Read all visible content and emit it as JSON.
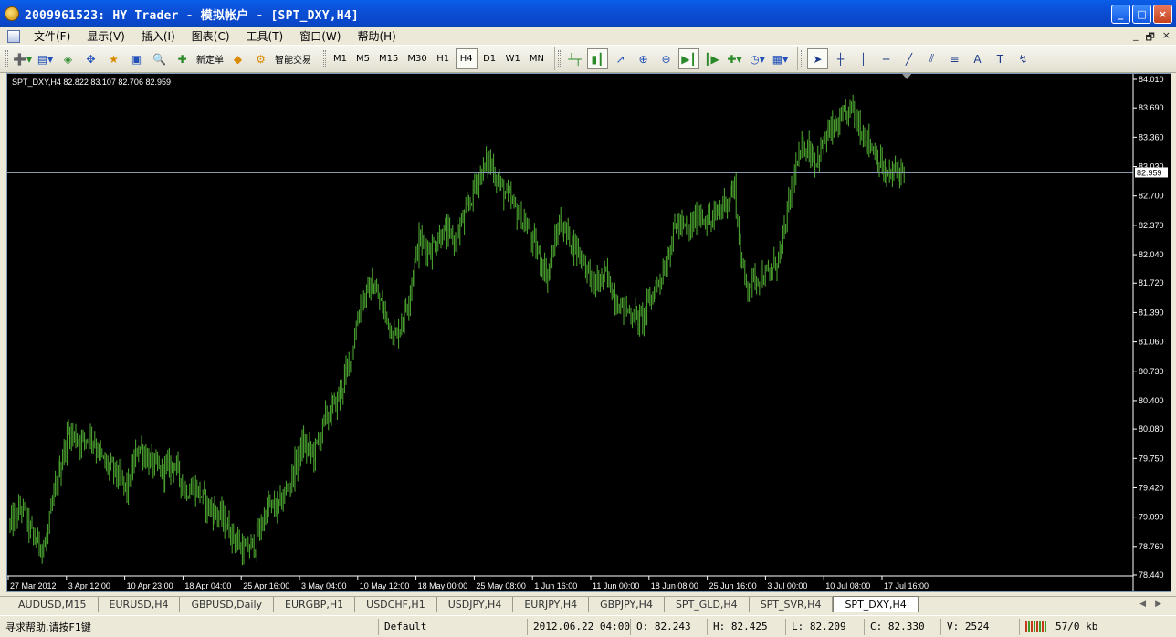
{
  "window": {
    "title": "2009961523: HY Trader - 模拟帐户 - [SPT_DXY,H4]",
    "controls": [
      "_",
      "□",
      "×"
    ]
  },
  "menu": {
    "items": [
      "文件(F)",
      "显示(V)",
      "插入(I)",
      "图表(C)",
      "工具(T)",
      "窗口(W)",
      "帮助(H)"
    ],
    "mdi_controls": [
      "_",
      "🗗",
      "×"
    ]
  },
  "toolbar": {
    "new_order_label": "新定单",
    "expert_label": "智能交易",
    "timeframes": [
      "M1",
      "M5",
      "M15",
      "M30",
      "H1",
      "H4",
      "D1",
      "W1",
      "MN"
    ],
    "active_timeframe": "H4"
  },
  "chart_data": {
    "type": "bar",
    "symbol_info": "SPT_DXY,H4  82.822 83.107 82.706 82.959",
    "current_price_label": "82.959",
    "current_price": 82.959,
    "y_ticks": [
      "84.010",
      "83.690",
      "83.360",
      "83.030",
      "82.700",
      "82.370",
      "82.040",
      "81.720",
      "81.390",
      "81.060",
      "80.730",
      "80.400",
      "80.080",
      "79.750",
      "79.420",
      "79.090",
      "78.760",
      "78.440"
    ],
    "ylim": [
      78.44,
      84.01
    ],
    "x_ticks": [
      "27 Mar 2012",
      "3 Apr 12:00",
      "10 Apr 23:00",
      "18 Apr 04:00",
      "25 Apr 16:00",
      "3 May 04:00",
      "10 May 12:00",
      "18 May 00:00",
      "25 May 08:00",
      "1 Jun 16:00",
      "11 Jun 00:00",
      "18 Jun 08:00",
      "25 Jun 16:00",
      "3 Jul 00:00",
      "10 Jul 08:00",
      "17 Jul 16:00"
    ],
    "path_anchors": [
      [
        0,
        79.0
      ],
      [
        8,
        79.2
      ],
      [
        16,
        78.85
      ],
      [
        24,
        78.75
      ],
      [
        32,
        79.5
      ],
      [
        40,
        80.05
      ],
      [
        48,
        79.95
      ],
      [
        56,
        80.0
      ],
      [
        64,
        79.7
      ],
      [
        72,
        79.6
      ],
      [
        80,
        79.4
      ],
      [
        88,
        79.9
      ],
      [
        96,
        79.7
      ],
      [
        104,
        79.6
      ],
      [
        112,
        79.7
      ],
      [
        120,
        79.4
      ],
      [
        128,
        79.4
      ],
      [
        136,
        79.2
      ],
      [
        144,
        79.1
      ],
      [
        152,
        78.9
      ],
      [
        160,
        78.7
      ],
      [
        168,
        78.8
      ],
      [
        176,
        79.2
      ],
      [
        184,
        79.2
      ],
      [
        192,
        79.5
      ],
      [
        200,
        79.9
      ],
      [
        208,
        79.8
      ],
      [
        216,
        80.2
      ],
      [
        224,
        80.4
      ],
      [
        232,
        80.8
      ],
      [
        240,
        81.5
      ],
      [
        248,
        81.7
      ],
      [
        256,
        81.4
      ],
      [
        264,
        81.1
      ],
      [
        272,
        81.5
      ],
      [
        280,
        82.2
      ],
      [
        288,
        82.1
      ],
      [
        296,
        82.3
      ],
      [
        304,
        82.2
      ],
      [
        312,
        82.5
      ],
      [
        320,
        82.9
      ],
      [
        328,
        83.1
      ],
      [
        336,
        82.8
      ],
      [
        344,
        82.6
      ],
      [
        352,
        82.4
      ],
      [
        360,
        82.1
      ],
      [
        368,
        81.8
      ],
      [
        376,
        82.4
      ],
      [
        384,
        82.2
      ],
      [
        392,
        82.0
      ],
      [
        400,
        81.7
      ],
      [
        408,
        81.8
      ],
      [
        416,
        81.5
      ],
      [
        424,
        81.4
      ],
      [
        432,
        81.3
      ],
      [
        440,
        81.6
      ],
      [
        448,
        81.9
      ],
      [
        456,
        82.4
      ],
      [
        464,
        82.3
      ],
      [
        472,
        82.5
      ],
      [
        480,
        82.4
      ],
      [
        488,
        82.6
      ],
      [
        496,
        82.8
      ],
      [
        500,
        82.0
      ],
      [
        504,
        81.7
      ],
      [
        512,
        81.8
      ],
      [
        520,
        81.8
      ],
      [
        528,
        82.1
      ],
      [
        536,
        82.9
      ],
      [
        544,
        83.3
      ],
      [
        552,
        83.1
      ],
      [
        560,
        83.4
      ],
      [
        568,
        83.5
      ],
      [
        576,
        83.7
      ],
      [
        584,
        83.4
      ],
      [
        592,
        83.2
      ],
      [
        600,
        82.9
      ],
      [
        608,
        83.0
      ],
      [
        612,
        82.959
      ]
    ]
  },
  "tabs": [
    "AUDUSD,M15",
    "EURUSD,H4",
    "GBPUSD,Daily",
    "EURGBP,H1",
    "USDCHF,H1",
    "USDJPY,H4",
    "EURJPY,H4",
    "GBPJPY,H4",
    "SPT_GLD,H4",
    "SPT_SVR,H4",
    "SPT_DXY,H4"
  ],
  "active_tab": "SPT_DXY,H4",
  "status": {
    "help": "寻求帮助,请按F1键",
    "profile": "Default",
    "datetime": "2012.06.22 04:00",
    "open": "O: 82.243",
    "high": "H: 82.425",
    "low": "L: 82.209",
    "close": "C: 82.330",
    "volume": "V: 2524",
    "traffic": "57/0 kb"
  },
  "colors": {
    "chart_bg": "#000000",
    "bars": "#4fae32",
    "axis_text": "#ffffff",
    "price_line": "#8a9aae"
  }
}
